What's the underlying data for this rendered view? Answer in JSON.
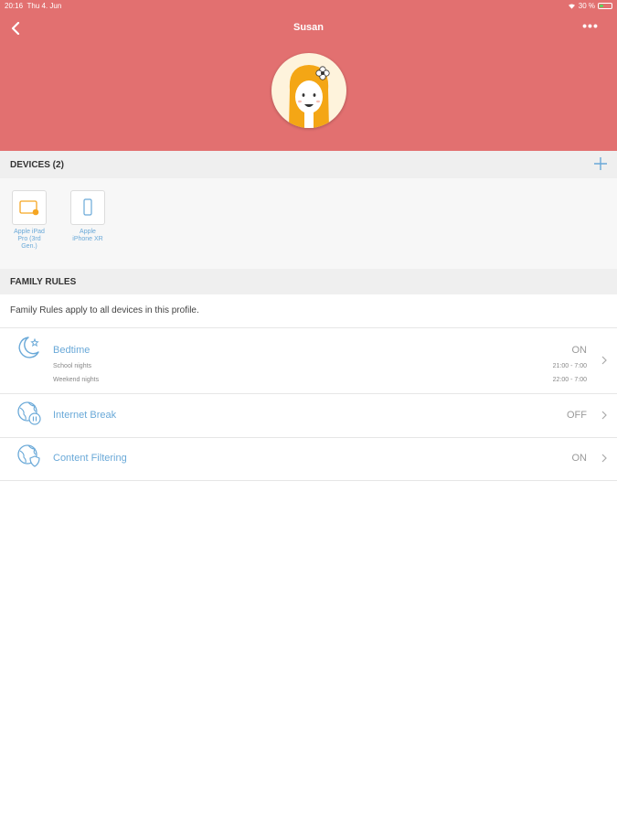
{
  "status_bar": {
    "time": "20:16",
    "date": "Thu 4. Jun",
    "battery": "30 %"
  },
  "header": {
    "title": "Susan",
    "more_label": "•••"
  },
  "devices_section": {
    "title": "DEVICES (2)",
    "devices": [
      {
        "label": "Apple iPad Pro (3rd Gen.)",
        "icon": "tablet-icon"
      },
      {
        "label": "Apple iPhone XR",
        "icon": "phone-icon"
      }
    ]
  },
  "family_rules": {
    "title": "FAMILY RULES",
    "description": "Family Rules apply to all devices in this profile.",
    "rules": [
      {
        "title": "Bedtime",
        "status": "ON",
        "icon": "moon-star-icon",
        "schedule": [
          {
            "label": "School nights",
            "value": "21:00 - 7:00"
          },
          {
            "label": "Weekend nights",
            "value": "22:00 - 7:00"
          }
        ]
      },
      {
        "title": "Internet Break",
        "status": "OFF",
        "icon": "globe-pause-icon"
      },
      {
        "title": "Content Filtering",
        "status": "ON",
        "icon": "globe-shield-icon"
      }
    ]
  },
  "colors": {
    "header_bg": "#e27070",
    "accent_blue": "#6aa9d8",
    "section_bg": "#efefef",
    "device_accent": "#f5a623"
  }
}
